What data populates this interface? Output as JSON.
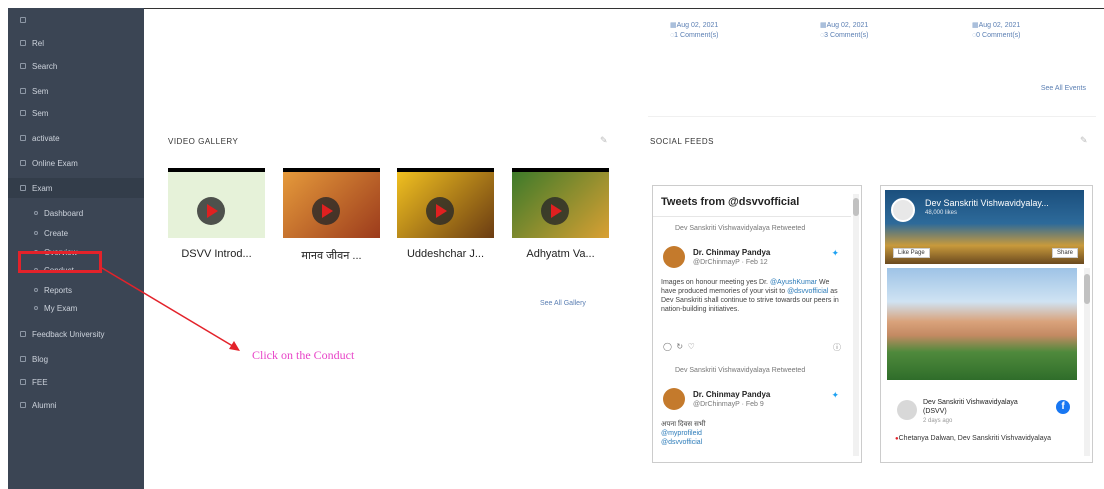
{
  "sidebar": {
    "items": [
      {
        "label": "",
        "sub": false
      },
      {
        "label": "Rel",
        "sub": false
      },
      {
        "label": "Search",
        "sub": false
      },
      {
        "label": "Sem",
        "sub": false
      },
      {
        "label": "Sem",
        "sub": false
      },
      {
        "label": "activate",
        "sub": false
      },
      {
        "label": "Online Exam",
        "sub": false
      },
      {
        "label": "Exam",
        "sub": false
      },
      {
        "label": "Dashboard",
        "sub": true
      },
      {
        "label": "Create",
        "sub": true
      },
      {
        "label": "Overview",
        "sub": true
      },
      {
        "label": "Conduct",
        "sub": true
      },
      {
        "label": "Reports",
        "sub": true
      },
      {
        "label": "My Exam",
        "sub": true
      },
      {
        "label": "Feedback University",
        "sub": false
      },
      {
        "label": "Blog",
        "sub": false
      },
      {
        "label": "FEE",
        "sub": false
      },
      {
        "label": "Alumni",
        "sub": false
      }
    ]
  },
  "top_events": [
    {
      "date": "Aug 02, 2021",
      "comments": "1 Comment(s)"
    },
    {
      "date": "Aug 02, 2021",
      "comments": "3 Comment(s)"
    },
    {
      "date": "Aug 02, 2021",
      "comments": "0 Comment(s)"
    }
  ],
  "top_seeall": "See All Events",
  "video_gallery": {
    "title": "VIDEO GALLERY",
    "videos": [
      {
        "title": "DSVV Introd...",
        "thumb_color": "#e6f2d9"
      },
      {
        "title": "मानव जीवन ...",
        "thumb_color": "#c96a2f"
      },
      {
        "title": "Uddeshchar J...",
        "thumb_color": "#5b3a18"
      },
      {
        "title": "Adhyatm Va...",
        "thumb_color": "#a9762a"
      }
    ],
    "seeall": "See All Gallery"
  },
  "annotation": {
    "callout": "Click on the Conduct"
  },
  "social": {
    "title": "SOCIAL FEEDS",
    "twitter": {
      "header": "Tweets from @dsvvofficial",
      "tweets": [
        {
          "retweeted_by": "Dev Sanskriti Vishwavidyalaya Retweeted",
          "name": "Dr. Chinmay Pandya",
          "handle": "@DrChinmayP · Feb 12",
          "text_pre": "Images on honour meeting yes Dr. ",
          "link1": "@AyushKumar",
          "text_mid": " We have produced memories of your visit to ",
          "link2": "@dsvvofficial",
          "text_post": " as Dev Sanskriti shall continue to strive towards our peers in nation-building initiatives."
        },
        {
          "retweeted_by": "Dev Sanskriti Vishwavidyalaya Retweeted",
          "name": "Dr. Chinmay Pandya",
          "handle": "@DrChinmayP · Feb 9",
          "text_pre": "अपना दिवस सभी",
          "link1": "@myprofileid",
          "text_mid": "",
          "link2": "@dsvvofficial",
          "text_post": ""
        }
      ]
    },
    "facebook": {
      "page_name": "Dev Sanskriti Vishwavidyalay...",
      "likes": "48,000 likes",
      "like_btn": "Like Page",
      "share_btn": "Share",
      "post_author": "Dev Sanskriti Vishwavidyalaya (DSVV)",
      "post_time": "2 days ago",
      "post_text": "Chetanya Dalwan, Dev Sanskriti Vishvavidyalaya"
    }
  }
}
